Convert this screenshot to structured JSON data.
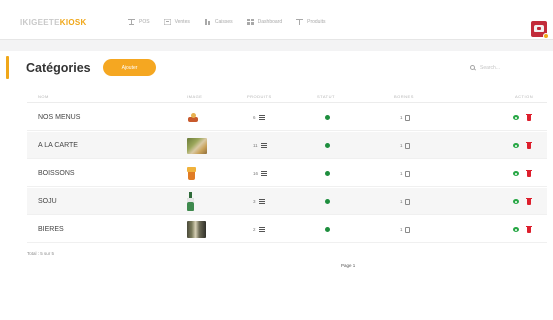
{
  "topbar": {
    "brand_part1": "IKIGEETE",
    "brand_part2": "KIOSK",
    "nav": [
      {
        "label": "POS",
        "icon": "pos-icon"
      },
      {
        "label": "Ventes",
        "icon": "sales-icon"
      },
      {
        "label": "Caisses",
        "icon": "cash-register-icon"
      },
      {
        "label": "Dashboard",
        "icon": "dashboard-icon"
      },
      {
        "label": "Produits",
        "icon": "products-icon"
      }
    ]
  },
  "page": {
    "title": "Catégories",
    "add_label": "Ajouter",
    "search_placeholder": "Search..."
  },
  "table": {
    "headers": [
      "NOM",
      "IMAGE",
      "PRODUITS",
      "STATUT",
      "BORNES",
      "ACTION"
    ],
    "rows": [
      {
        "name": "NOS MENUS",
        "products": "6",
        "bornes": "1",
        "status": "active"
      },
      {
        "name": "A LA CARTE",
        "products": "11",
        "bornes": "1",
        "status": "active"
      },
      {
        "name": "BOISSONS",
        "products": "16",
        "bornes": "1",
        "status": "active"
      },
      {
        "name": "SOJU",
        "products": "3",
        "bornes": "1",
        "status": "active"
      },
      {
        "name": "BIERES",
        "products": "2",
        "bornes": "1",
        "status": "active"
      }
    ]
  },
  "footer": {
    "total": "Total : 5 sur 5",
    "page_label": "Page 1"
  },
  "colors": {
    "accent": "#f0a719",
    "status_active": "#1e8e3e",
    "view": "#27a745",
    "delete": "#dd1f2d"
  }
}
